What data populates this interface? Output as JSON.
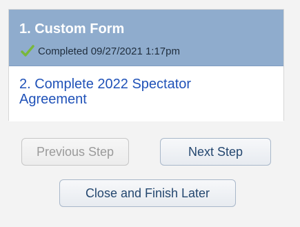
{
  "steps": [
    {
      "title": "1. Custom Form",
      "status": "Completed 09/27/2021 1:17pm",
      "status_icon": "check-icon",
      "active": true
    },
    {
      "title": "2. Complete 2022 Spectator Agreement",
      "active": false
    }
  ],
  "buttons": {
    "previous_label": "Previous Step",
    "previous_disabled": true,
    "next_label": "Next Step",
    "close_label": "Close and Finish Later"
  },
  "colors": {
    "active_step_bg": "#8faccd",
    "link": "#2052b8",
    "check": "#79b83b"
  }
}
